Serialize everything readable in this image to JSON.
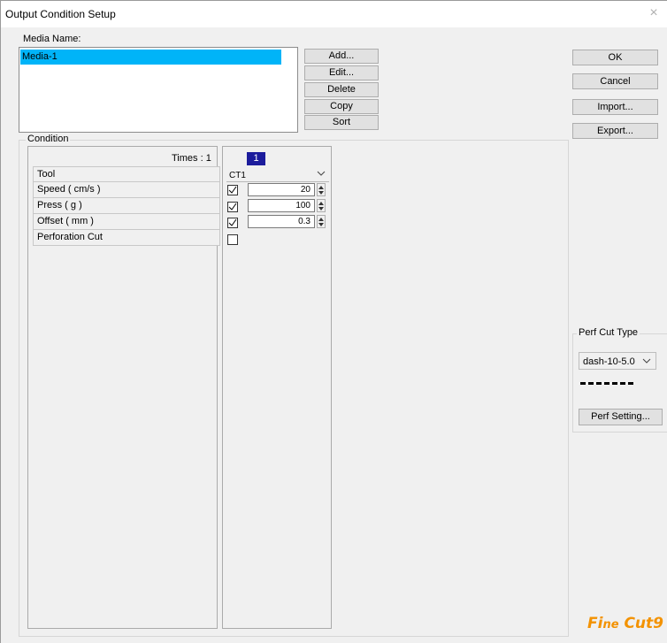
{
  "window": {
    "title": "Output Condition Setup",
    "close_glyph": "×"
  },
  "media": {
    "label": "Media Name:",
    "items": [
      "Media-1"
    ],
    "selected_color": "#00b4f8"
  },
  "media_buttons": {
    "add": "Add...",
    "edit": "Edit...",
    "delete": "Delete",
    "copy": "Copy",
    "sort": "Sort"
  },
  "dialog_buttons": {
    "ok": "OK",
    "cancel": "Cancel",
    "import": "Import...",
    "export": "Export..."
  },
  "condition": {
    "group_title": "Condition",
    "times_label": "Times : 1",
    "rows": [
      "Tool",
      "Speed ( cm/s )",
      "Press ( g )",
      "Offset ( mm )",
      "Perforation Cut"
    ],
    "column_header": "1",
    "column_header_color": "#1c1c9c",
    "tool_value": "CT1",
    "speed": {
      "checked": true,
      "value": "20"
    },
    "press": {
      "checked": true,
      "value": "100"
    },
    "offset": {
      "checked": true,
      "value": "0.3"
    },
    "perforation": {
      "checked": false
    }
  },
  "perf": {
    "group_title": "Perf Cut Type",
    "type_value": "dash-10-5.0",
    "setting_button": "Perf Setting..."
  },
  "logo": {
    "text_a": "Fi",
    "text_b": "ne",
    "text_c": " Cut",
    "text_d": "9",
    "color": "#f39200"
  },
  "icons": {
    "close": "close-icon",
    "dropdown": "chevron-down-icon",
    "check": "check-icon",
    "spin_up": "spin-up-icon",
    "spin_down": "spin-down-icon"
  }
}
